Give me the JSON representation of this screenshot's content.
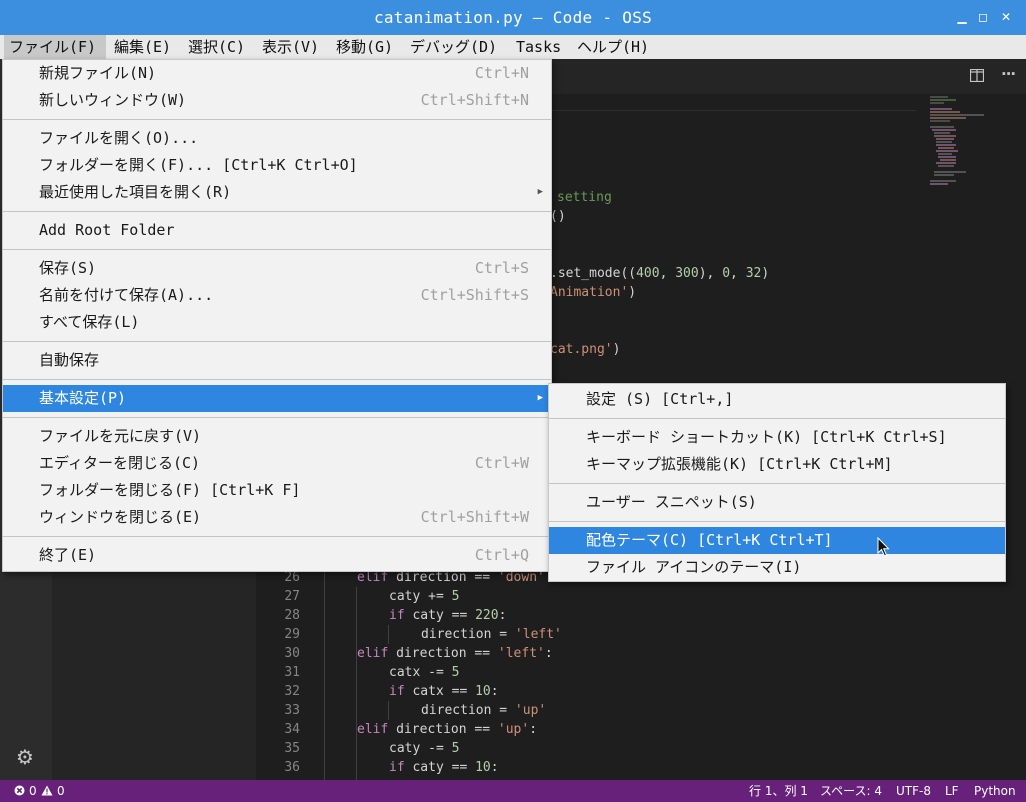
{
  "window": {
    "title": "catanimation.py — Code - OSS",
    "controls": [
      "▁",
      "◻",
      "✕"
    ]
  },
  "menubar": {
    "items": [
      "ファイル(F)",
      "編集(E)",
      "選択(C)",
      "表示(V)",
      "移動(G)",
      "デバッグ(D)",
      "Tasks",
      "ヘルプ(H)"
    ]
  },
  "file_menu": {
    "new_file": {
      "label": "新規ファイル(N)",
      "shortcut": "Ctrl+N"
    },
    "new_window": {
      "label": "新しいウィンドウ(W)",
      "shortcut": "Ctrl+Shift+N"
    },
    "open_file": {
      "label": "ファイルを開く(O)..."
    },
    "open_folder": {
      "label": "フォルダーを開く(F)... [Ctrl+K Ctrl+O]"
    },
    "open_recent": {
      "label": "最近使用した項目を開く(R)"
    },
    "add_root_folder": {
      "label": "Add Root Folder"
    },
    "save": {
      "label": "保存(S)",
      "shortcut": "Ctrl+S"
    },
    "save_as": {
      "label": "名前を付けて保存(A)...",
      "shortcut": "Ctrl+Shift+S"
    },
    "save_all": {
      "label": "すべて保存(L)"
    },
    "auto_save": {
      "label": "自動保存"
    },
    "preferences": {
      "label": "基本設定(P)"
    },
    "revert_file": {
      "label": "ファイルを元に戻す(V)"
    },
    "close_editor": {
      "label": "エディターを閉じる(C)",
      "shortcut": "Ctrl+W"
    },
    "close_folder": {
      "label": "フォルダーを閉じる(F) [Ctrl+K F]"
    },
    "close_window": {
      "label": "ウィンドウを閉じる(E)",
      "shortcut": "Ctrl+Shift+W"
    },
    "exit": {
      "label": "終了(E)",
      "shortcut": "Ctrl+Q"
    }
  },
  "prefs_submenu": {
    "settings": "設定 (S) [Ctrl+,]",
    "keyboard_shortcuts": "キーボード ショートカット(K) [Ctrl+K Ctrl+S]",
    "keymap_extensions": "キーマップ拡張機能(K) [Ctrl+K Ctrl+M]",
    "user_snippets": "ユーザー スニペット(S)",
    "color_theme": "配色テーマ(C) [Ctrl+K Ctrl+T]",
    "file_icon_theme": "ファイル アイコンのテーマ(I)"
  },
  "code_fragments": {
    "f1": "setting",
    "f2": "()",
    "f3a": ".set_mode((",
    "f3b": "400",
    "f3c": ", ",
    "f3d": "300",
    "f3e": "), ",
    "f3f": "0",
    "f3g": ", ",
    "f3h": "32",
    "f3i": ")",
    "f4a": "Animation'",
    "f4b": ")",
    "f5a": "cat.png'",
    "f5b": ")"
  },
  "code_lines": {
    "n26": "26",
    "n27": "27",
    "n28": "28",
    "n29": "29",
    "n30": "30",
    "n31": "31",
    "n32": "32",
    "n33": "33",
    "n34": "34",
    "n35": "35",
    "n36": "36",
    "kw_elif": "elif",
    "kw_if": "if",
    "l26a": " direction == ",
    "l26b": "'down'",
    "l27a": "caty += ",
    "l27b": "5",
    "l28a": " caty == ",
    "l28b": "220",
    "l28c": ":",
    "l29a": "direction = ",
    "l29b": "'left'",
    "l30a": " direction == ",
    "l30b": "'left'",
    "l30c": ":",
    "l31a": "catx -= ",
    "l31b": "5",
    "l32a": " catx == ",
    "l32b": "10",
    "l32c": ":",
    "l33a": "direction = ",
    "l33b": "'up'",
    "l34a": " direction == ",
    "l34b": "'up'",
    "l34c": ":",
    "l35a": "caty -= ",
    "l35b": "5",
    "l36a": " caty == ",
    "l36b": "10",
    "l36c": ":"
  },
  "statusbar": {
    "errors": "0",
    "warnings": "0",
    "position": "行 1、列 1",
    "spaces": "スペース: 4",
    "encoding": "UTF-8",
    "eol": "LF",
    "language": "Python"
  },
  "colors": {
    "titlebar": "#3c8fde",
    "menu_highlight": "#2f86e0",
    "statusbar": "#68217a",
    "keyword": "#c586c0",
    "string": "#ce9178",
    "number": "#b5cea8",
    "comment": "#6a9955"
  },
  "icons": [
    "minimize-icon",
    "maximize-icon",
    "close-icon",
    "split-editor-icon",
    "more-actions-icon",
    "gear-icon",
    "error-icon",
    "warning-icon",
    "submenu-arrow-icon",
    "mouse-pointer-icon"
  ]
}
